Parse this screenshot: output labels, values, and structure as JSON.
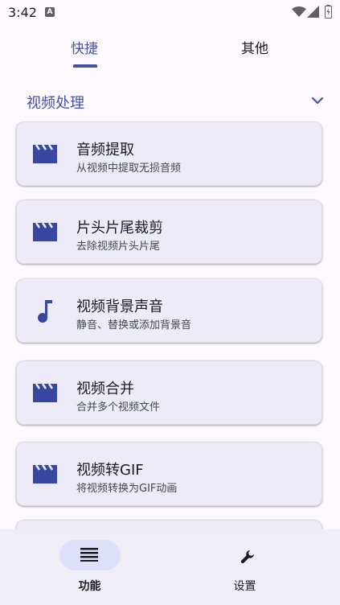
{
  "status_bar": {
    "time": "3:42",
    "notification_badge": "A"
  },
  "tabs": [
    {
      "label": "快捷",
      "active": true
    },
    {
      "label": "其他",
      "active": false
    }
  ],
  "section": {
    "title": "视频处理",
    "expanded": true
  },
  "cards": [
    {
      "title": "音频提取",
      "subtitle": "从视频中提取无损音频",
      "icon": "clapperboard-icon"
    },
    {
      "title": "片头片尾裁剪",
      "subtitle": "去除视频片头片尾",
      "icon": "clapperboard-icon"
    },
    {
      "title": "视频背景声音",
      "subtitle": "静音、替换或添加背景音",
      "icon": "music-note-icon"
    },
    {
      "title": "视频合并",
      "subtitle": "合并多个视频文件",
      "icon": "clapperboard-icon"
    },
    {
      "title": "视频转GIF",
      "subtitle": "将视频转换为GIF动画",
      "icon": "clapperboard-icon"
    }
  ],
  "bottom_nav": [
    {
      "label": "功能",
      "icon": "list-icon",
      "selected": true
    },
    {
      "label": "设置",
      "icon": "wrench-icon",
      "selected": false
    }
  ],
  "colors": {
    "accent": "#4453a3",
    "background": "#fcf8fd",
    "card": "#ecebf7",
    "nav_background": "#efedf6",
    "nav_pill": "#dee0fa"
  }
}
